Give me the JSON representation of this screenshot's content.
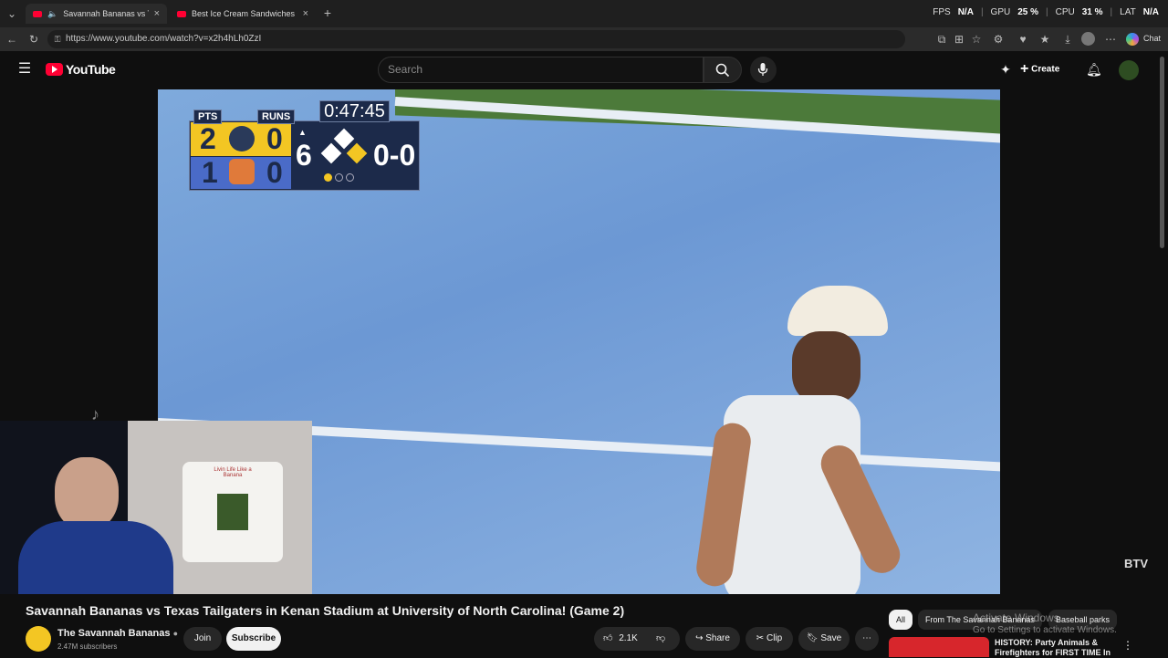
{
  "browser": {
    "tabs": [
      {
        "title": "Savannah Bananas vs Texas Ta",
        "active": true
      },
      {
        "title": "Best Ice Cream Sandwiches Comp",
        "active": false
      }
    ],
    "url": "https://www.youtube.com/watch?v=x2h4hLh0ZzI",
    "chat_label": "Chat",
    "overlay": {
      "fps_label": "FPS",
      "fps_value": "N/A",
      "gpu_label": "GPU",
      "gpu_value": "25 %",
      "cpu_label": "CPU",
      "cpu_value": "31 %",
      "lat_label": "LAT",
      "lat_value": "N/A"
    }
  },
  "youtube": {
    "logo_text": "YouTube",
    "search_placeholder": "Search",
    "create_label": "Create"
  },
  "scoreboard": {
    "pts_label": "PTS",
    "runs_label": "RUNS",
    "timer": "0:47:45",
    "team1_pts": "2",
    "team1_runs": "0",
    "team2_pts": "1",
    "team2_runs": "0",
    "inning": "6",
    "count": "0-0"
  },
  "video": {
    "watermark": "BTV"
  },
  "webcam": {
    "shirt_text": "Livin Life Like a Banana"
  },
  "watch": {
    "title": "Savannah Bananas vs Texas Tailgaters in Kenan Stadium at University of North Carolina! (Game 2)",
    "channel": "The Savannah Bananas",
    "subscribers": "2.47M subscribers",
    "join_label": "Join",
    "subscribe_label": "Subscribe",
    "likes": "2.1K",
    "share_label": "Share",
    "clip_label": "Clip",
    "save_label": "Save"
  },
  "sidebar": {
    "chips": [
      "All",
      "From The Savannah Bananas",
      "Baseball parks"
    ],
    "rec_title": "HISTORY: Party Animals & Firefighters for FIRST TIME In"
  },
  "windows_notice": {
    "line1": "Activate Windows",
    "line2": "Go to Settings to activate Windows."
  }
}
